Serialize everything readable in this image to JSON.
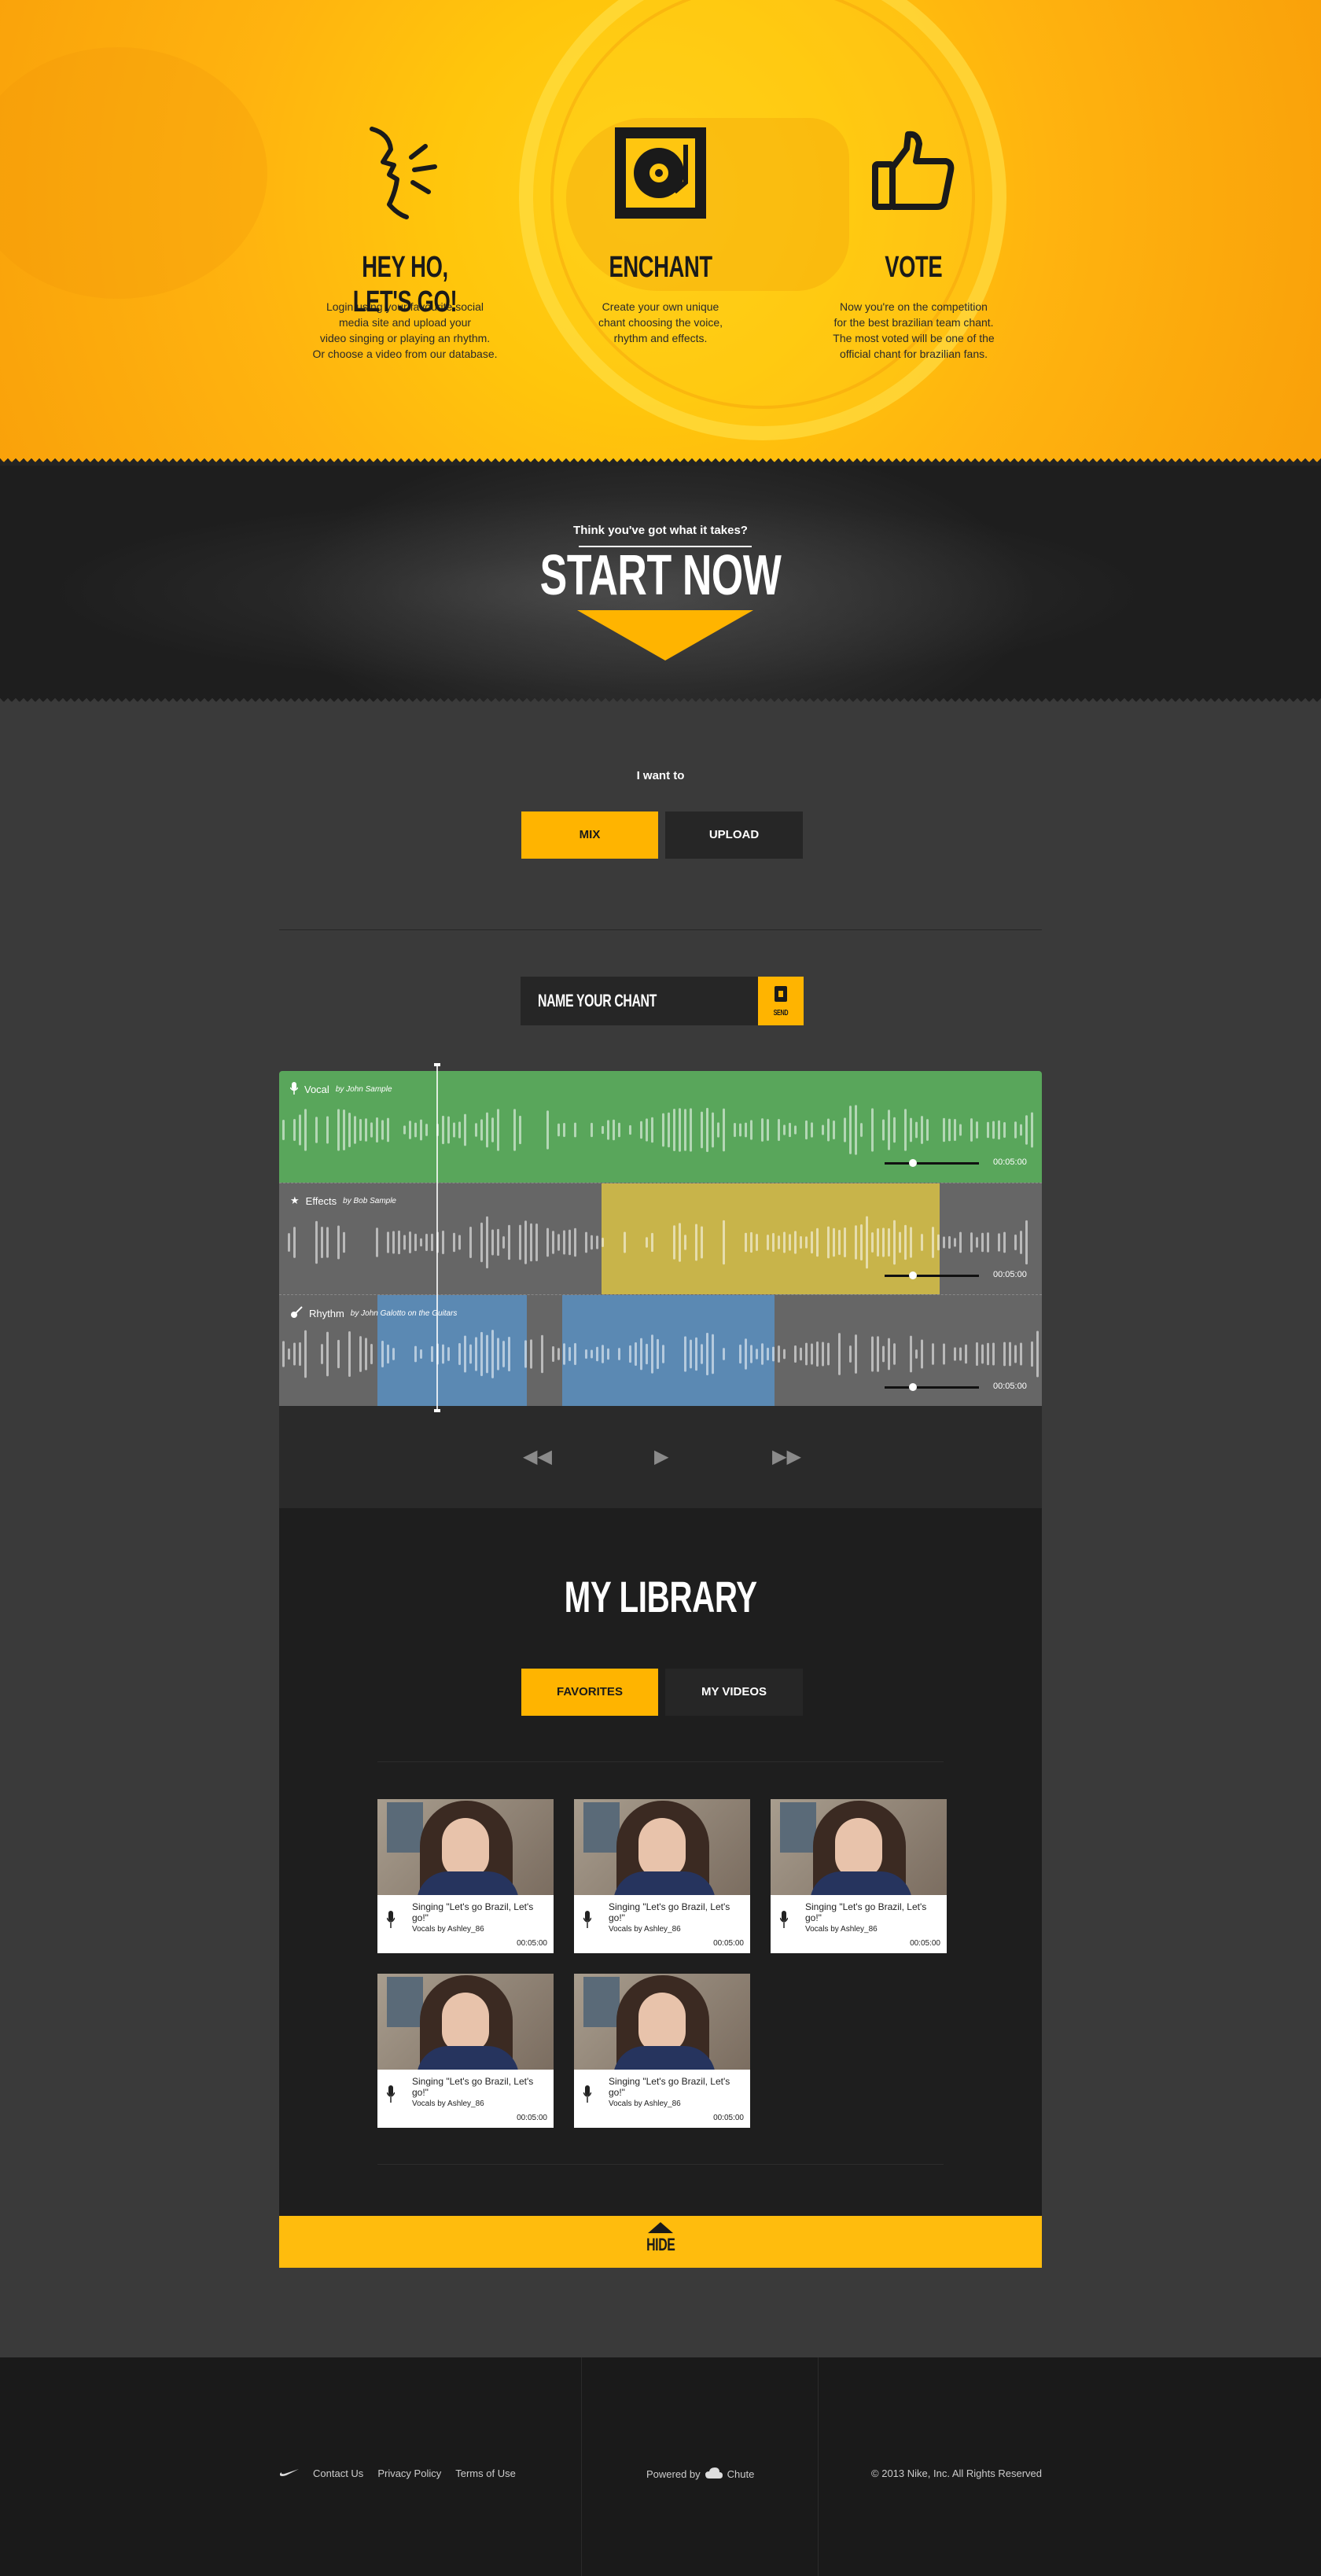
{
  "features": [
    {
      "icon": "shout-icon",
      "title": "HEY HO, LET'S GO!",
      "text": [
        "Login using your favourite social",
        "media site and upload your",
        "video singing or playing an rhythm.",
        "Or choose a video from our database."
      ]
    },
    {
      "icon": "turntable-icon",
      "title": "ENCHANT",
      "text": [
        "Create your own unique",
        "chant choosing the voice,",
        "rhythm and effects."
      ]
    },
    {
      "icon": "thumbs-up-icon",
      "title": "VOTE",
      "text": [
        "Now you're on the competition",
        "for the best brazilian team chant.",
        "The most voted will be one of the",
        "official chant for brazilian fans."
      ]
    }
  ],
  "start": {
    "question": "Think you've got what it takes?",
    "cta": "START NOW"
  },
  "mix": {
    "prompt": "I want to",
    "tabs": [
      {
        "label": "MIX",
        "active": true
      },
      {
        "label": "UPLOAD",
        "active": false
      }
    ],
    "name_placeholder": "NAME YOUR CHANT",
    "send_label": "SEND"
  },
  "tracks": [
    {
      "name": "Vocal",
      "by": "by John Sample",
      "time": "00:05:00",
      "icon": "microphone-icon",
      "volume": 0.3
    },
    {
      "name": "Effects",
      "by": "by Bob Sample",
      "time": "00:05:00",
      "icon": "star-icon",
      "volume": 0.3
    },
    {
      "name": "Rhythm",
      "by": "by John Galotto on the Guitars",
      "time": "00:05:00",
      "icon": "guitar-icon",
      "volume": 0.3
    }
  ],
  "library": {
    "title": "MY LIBRARY",
    "tabs": [
      {
        "label": "FAVORITES",
        "active": true
      },
      {
        "label": "MY VIDEOS",
        "active": false
      }
    ],
    "items": [
      {
        "title": "Singing \"Let's go Brazil, Let's go!\"",
        "sub": "Vocals by Ashley_86",
        "time": "00:05:00"
      },
      {
        "title": "Singing \"Let's go Brazil, Let's go!\"",
        "sub": "Vocals by Ashley_86",
        "time": "00:05:00"
      },
      {
        "title": "Singing \"Let's go Brazil, Let's go!\"",
        "sub": "Vocals by Ashley_86",
        "time": "00:05:00"
      },
      {
        "title": "Singing \"Let's go Brazil, Let's go!\"",
        "sub": "Vocals by Ashley_86",
        "time": "00:05:00"
      },
      {
        "title": "Singing \"Let's go Brazil, Let's go!\"",
        "sub": "Vocals by Ashley_86",
        "time": "00:05:00"
      }
    ],
    "hide_label": "HIDE"
  },
  "footer": {
    "links": [
      "Contact Us",
      "Privacy Policy",
      "Terms of Use"
    ],
    "powered_by": "Powered by",
    "powered_brand": "Chute",
    "copyright": "© 2013 Nike, Inc. All Rights Reserved"
  },
  "colors": {
    "accent": "#ffb400",
    "vocal": "#59a65b",
    "effects_region": "#c8b44a",
    "rhythm_region": "#5b89b3",
    "dark": "#262626"
  }
}
